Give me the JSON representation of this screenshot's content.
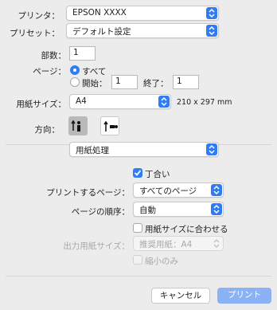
{
  "printer": {
    "label": "プリンタ：",
    "value": "EPSON XXXX"
  },
  "preset": {
    "label": "プリセット：",
    "value": "デフォルト設定"
  },
  "copies": {
    "label": "部数：",
    "value": "1"
  },
  "pages": {
    "label": "ページ：",
    "all_label": "すべて",
    "from_label": "開始：",
    "from_value": "1",
    "to_label": "終了：",
    "to_value": "1"
  },
  "paper_size": {
    "label": "用紙サイズ：",
    "value": "A4",
    "dimensions": "210 x 297 mm"
  },
  "orientation": {
    "label": "方向："
  },
  "section_menu": {
    "value": "用紙処理"
  },
  "collate": {
    "label": "丁合い"
  },
  "pages_to_print": {
    "label": "プリントするページ：",
    "value": "すべてのページ"
  },
  "page_order": {
    "label": "ページの順序：",
    "value": "自動"
  },
  "scale_to_fit": {
    "label": "用紙サイズに合わせる"
  },
  "output_paper_size": {
    "label": "出力用紙サイズ：",
    "value": "推奨用紙：A4"
  },
  "scale_down_only": {
    "label": "縮小のみ"
  },
  "buttons": {
    "cancel": "キャンセル",
    "print": "プリント"
  },
  "colors": {
    "accent": "#2f7cf6",
    "print_button": "#8ab2f5"
  }
}
